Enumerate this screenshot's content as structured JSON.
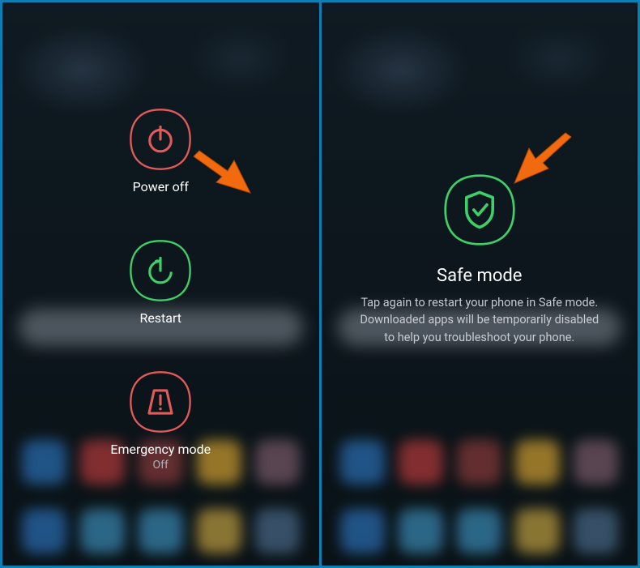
{
  "left": {
    "power_off": {
      "label": "Power off",
      "color": "#e25a5a"
    },
    "restart": {
      "label": "Restart",
      "color": "#3fd06a"
    },
    "emergency": {
      "label": "Emergency mode",
      "sub": "Off",
      "color": "#e25a5a"
    }
  },
  "right": {
    "safe_mode": {
      "title": "Safe mode",
      "desc": "Tap again to restart your phone in Safe mode. Downloaded apps will be temporarily disabled to help you troubleshoot your phone.",
      "color": "#3fd06a"
    }
  },
  "arrow_color": "#f26a0f"
}
